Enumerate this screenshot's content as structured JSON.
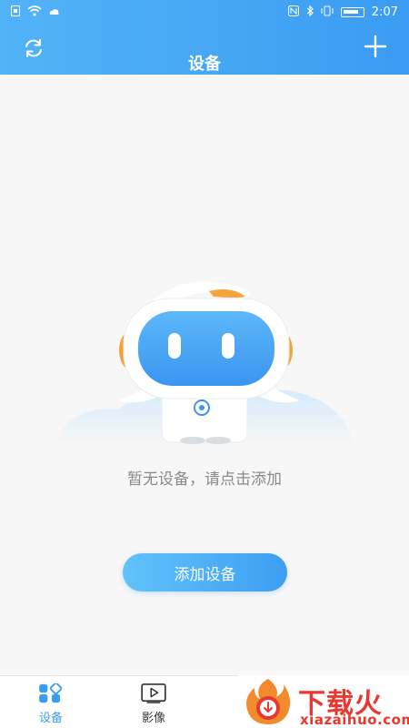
{
  "statusbar": {
    "time": "2:07",
    "left_icons": [
      "sim-icon",
      "wifi-icon",
      "cloud-icon"
    ],
    "right_icons": [
      "nfc-icon",
      "bluetooth-icon",
      "vibrate-icon",
      "battery-icon"
    ]
  },
  "header": {
    "title": "设备",
    "left_icon": "refresh-icon",
    "right_icon": "plus-icon"
  },
  "empty_state": {
    "message": "暂无设备，请点击添加",
    "button_label": "添加设备",
    "illustration": "robot-illustration"
  },
  "tabbar": {
    "tabs": [
      {
        "label": "设备",
        "icon": "devices-icon",
        "active": true
      },
      {
        "label": "影像",
        "icon": "play-icon",
        "active": false
      }
    ]
  },
  "watermark": {
    "title": "下载火",
    "subtitle": "xiazaihuo.com"
  },
  "colors": {
    "header_start": "#53b3f7",
    "header_end": "#3a9cf2",
    "accent": "#3a9cf2",
    "watermark_red": "#e8382f"
  }
}
